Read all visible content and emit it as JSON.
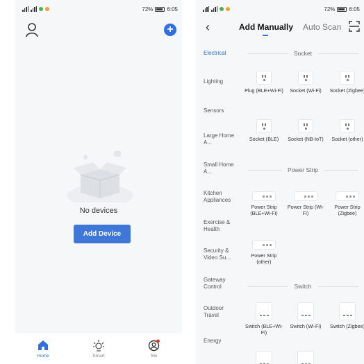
{
  "status_bar": {
    "battery": "72%",
    "time": "6:05"
  },
  "home": {
    "empty_text": "No devices",
    "add_button": "Add Device",
    "tabs": [
      {
        "label": "Home",
        "icon": "home-icon"
      },
      {
        "label": "Smart",
        "icon": "sun-icon"
      },
      {
        "label": "Me",
        "icon": "user-icon"
      }
    ]
  },
  "add_device": {
    "tabs": [
      "Add Manually",
      "Auto Scan"
    ],
    "categories": [
      "Electrical",
      "Lighting",
      "Sensors",
      "Large Home A...",
      "Small Home A...",
      "Kitchen Appliances",
      "Exercise & Health",
      "Security & Video Su...",
      "Gateway Control",
      "Outdoor Travel",
      "Energy"
    ],
    "sections": [
      {
        "title": "Socket",
        "items": [
          "Plug (BLE+Wi-Fi)",
          "Socket (Wi-Fi)",
          "Socket (Zigbee)",
          "Socket (BLE)",
          "Socket (NB-IoT)",
          "Socket (other)"
        ]
      },
      {
        "title": "Power Strip",
        "items": [
          "Power Strip (BLE+Wi-Fi)",
          "Power Strip (Wi-Fi)",
          "Power Strip (Zigbee)",
          "Power Strip (other)"
        ]
      },
      {
        "title": "Switch",
        "items": [
          "Switch (BLE+Wi-Fi)",
          "Switch (Wi-Fi)",
          "Switch (Zigbee)"
        ]
      }
    ]
  },
  "colors": {
    "accent": "#2f6fe6",
    "button": "#3f77d8",
    "badge": "#e53935"
  }
}
